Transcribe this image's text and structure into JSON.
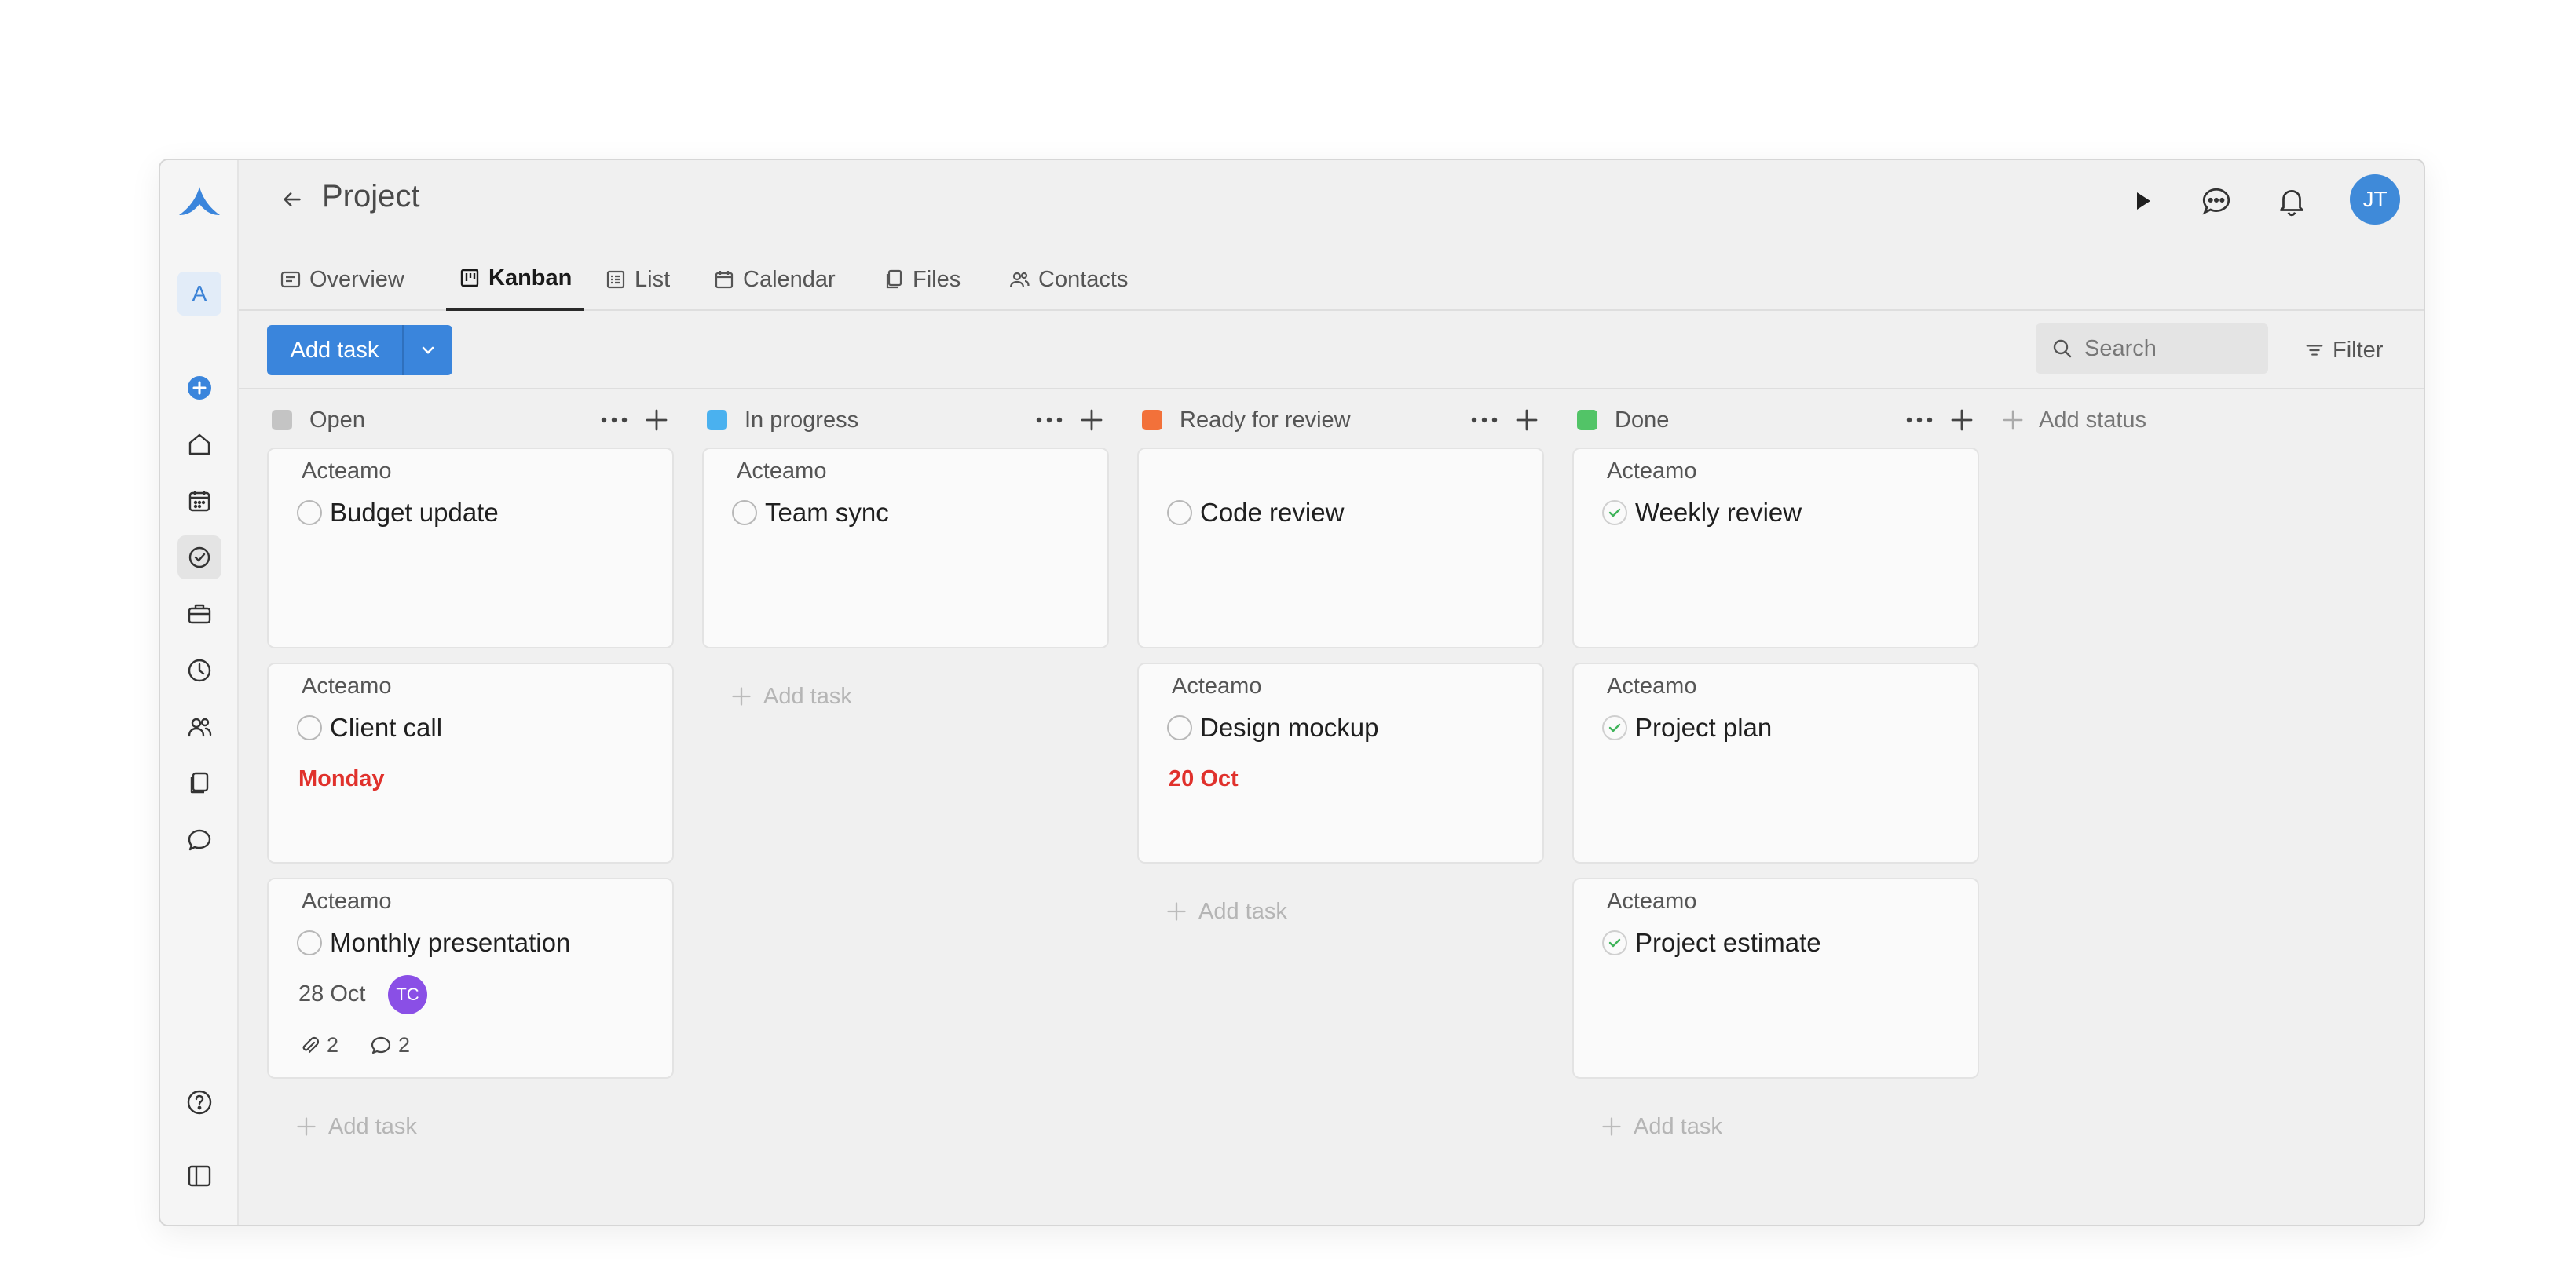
{
  "app": {
    "workspace_initial": "A",
    "accent": "#3a85dc"
  },
  "header": {
    "title": "Project",
    "avatar_initials": "JT"
  },
  "tabs": [
    {
      "label": "Overview",
      "icon": "overview-icon"
    },
    {
      "label": "Kanban",
      "icon": "kanban-icon",
      "active": true
    },
    {
      "label": "List",
      "icon": "list-icon"
    },
    {
      "label": "Calendar",
      "icon": "calendar-icon"
    },
    {
      "label": "Files",
      "icon": "files-icon"
    },
    {
      "label": "Contacts",
      "icon": "contacts-icon"
    }
  ],
  "toolbar": {
    "add_task_label": "Add task",
    "search_placeholder": "Search",
    "filter_label": "Filter"
  },
  "columns": [
    {
      "name": "Open",
      "color": "#c4c4c4",
      "cards": [
        {
          "project": "Acteamo",
          "title": "Budget update"
        },
        {
          "project": "Acteamo",
          "title": "Client call",
          "due": "Monday"
        },
        {
          "project": "Acteamo",
          "title": "Monthly presentation",
          "due": "28 Oct",
          "assignee": "TC",
          "attachments": "2",
          "comments": "2"
        }
      ],
      "add_label": "Add task"
    },
    {
      "name": "In progress",
      "color": "#4ab1ef",
      "cards": [
        {
          "project": "Acteamo",
          "title": "Team sync"
        }
      ],
      "add_label": "Add task"
    },
    {
      "name": "Ready for review",
      "color": "#f2713a",
      "cards": [
        {
          "project": "",
          "title": "Code review"
        },
        {
          "project": "Acteamo",
          "title": "Design mockup",
          "due": "20 Oct"
        }
      ],
      "add_label": "Add task"
    },
    {
      "name": "Done",
      "color": "#52c467",
      "cards": [
        {
          "project": "Acteamo",
          "title": "Weekly review"
        },
        {
          "project": "Acteamo",
          "title": "Project plan"
        },
        {
          "project": "Acteamo",
          "title": "Project estimate"
        }
      ],
      "add_label": "Add task"
    }
  ],
  "add_status_label": "Add status"
}
